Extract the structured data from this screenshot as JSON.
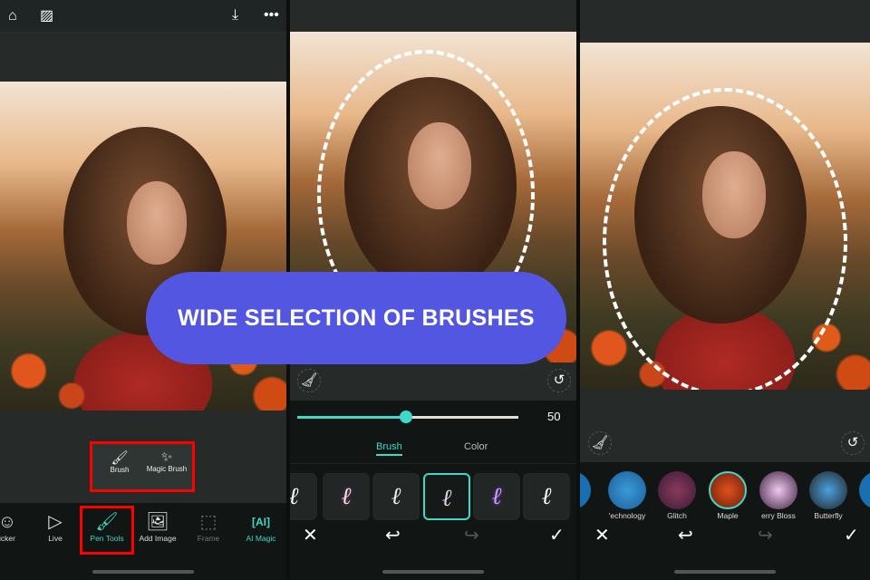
{
  "panel1": {
    "topbar": {
      "icons": [
        "home-icon",
        "gallery-icon",
        "download-icon",
        "more-icon"
      ]
    },
    "popup": {
      "items": [
        {
          "label": "Brush",
          "icon": "brush-icon"
        },
        {
          "label": "Magic Brush",
          "icon": "magic-wand-icon"
        }
      ]
    },
    "toolbar": {
      "items": [
        {
          "label": "Sticker",
          "display": "icker"
        },
        {
          "label": "Live"
        },
        {
          "label": "Pen Tools",
          "active": true
        },
        {
          "label": "Add Image"
        },
        {
          "label": "Frame",
          "disabled": true
        },
        {
          "label": "AI Magic"
        }
      ]
    }
  },
  "panel2": {
    "slider": {
      "value": 50,
      "fraction": 0.5,
      "display": "50"
    },
    "tabs": [
      {
        "label": "Brush",
        "active": true
      },
      {
        "label": "Color"
      }
    ],
    "selected_brush_index": 3
  },
  "panel3": {
    "effects": [
      {
        "label": "Technology",
        "display": "'echnology"
      },
      {
        "label": "Glitch"
      },
      {
        "label": "Maple",
        "selected": true
      },
      {
        "label": "Cherry Blossom",
        "display": "erry Bloss"
      },
      {
        "label": "Butterfly"
      }
    ]
  },
  "banner": {
    "text": "WIDE SELECTION OF BRUSHES"
  },
  "colors": {
    "accent": "#3fd9c9",
    "banner": "#5356e0",
    "highlight": "#ff0000"
  }
}
